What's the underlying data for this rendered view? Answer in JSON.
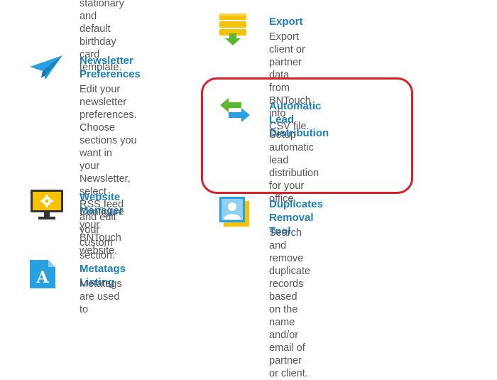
{
  "colors": {
    "link": "#1e7fb8",
    "text": "#555555",
    "highlight": "#d9202c",
    "icon_yellow": "#f6c100",
    "icon_green": "#5cb82e",
    "icon_blue": "#2aa0e0"
  },
  "items": {
    "birthday": {
      "desc": "stationary and default\nbirthday card template."
    },
    "newsletter": {
      "icon": "paper-plane-icon",
      "title": "Newsletter\nPreferences",
      "desc": "Edit your newsletter\npreferences. Choose\nsections you want in\nyour Newsletter, select\nRSS feed and edit your\ncustom section."
    },
    "website": {
      "icon": "monitor-gear-icon",
      "title": "Website Manager",
      "desc": "Configure your\nBNTouch website."
    },
    "metatags": {
      "icon": "document-a-icon",
      "title": "Metatags Listing",
      "desc": "Metatags are used to"
    },
    "export": {
      "icon": "database-export-icon",
      "title": "Export",
      "desc": "Export client or partner\ndata from BNTouch into\nCSV file."
    },
    "lead": {
      "icon": "swap-arrows-icon",
      "title": "Automatic Lead\nDistribution",
      "desc": "Setup automatic lead\ndistribution for your\noffice."
    },
    "duplicates": {
      "icon": "duplicate-contacts-icon",
      "title": "Duplicates Removal\nTool",
      "desc": "Search and remove\nduplicate records\nbased on the name\nand/or email of partner\nor client."
    }
  }
}
